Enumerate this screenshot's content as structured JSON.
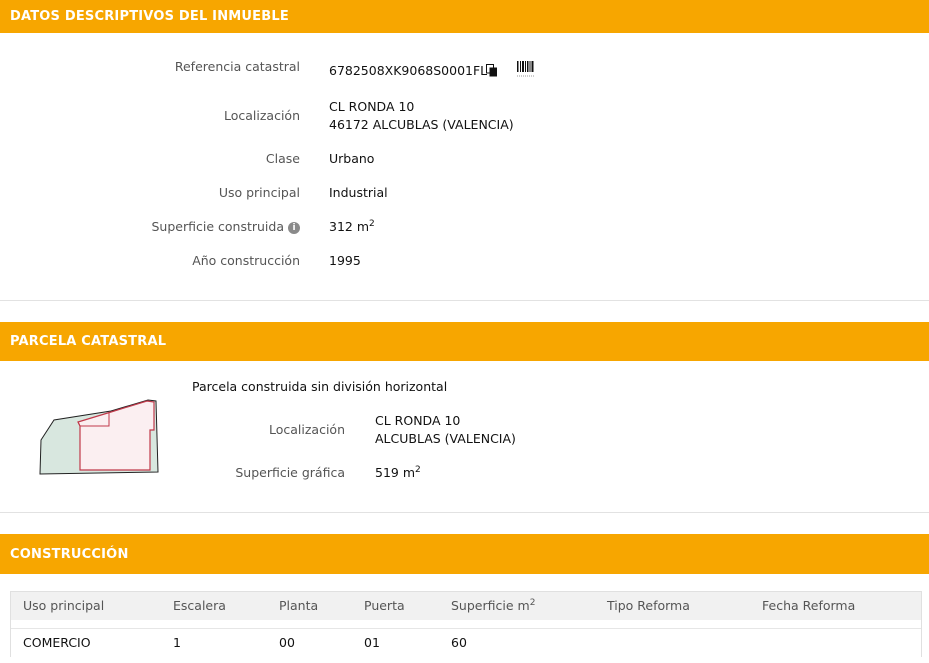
{
  "inmueble": {
    "header": "DATOS DESCRIPTIVOS DEL INMUEBLE",
    "ref_label": "Referencia catastral",
    "ref_value": "6782508XK9068S0001FL",
    "loc_label": "Localización",
    "loc_line1": "CL RONDA 10",
    "loc_line2": "46172 ALCUBLAS (VALENCIA)",
    "clase_label": "Clase",
    "clase_value": "Urbano",
    "uso_label": "Uso principal",
    "uso_value": "Industrial",
    "sup_label": "Superficie construida",
    "sup_value": "312 m",
    "sup_unit_exp": "2",
    "anio_label": "Año construcción",
    "anio_value": "1995"
  },
  "parcela": {
    "header": "PARCELA CATASTRAL",
    "title": "Parcela construida sin división horizontal",
    "loc_label": "Localización",
    "loc_line1": "CL RONDA 10",
    "loc_line2": "ALCUBLAS (VALENCIA)",
    "sup_label": "Superficie gráfica",
    "sup_value": "519 m",
    "sup_unit_exp": "2"
  },
  "construccion": {
    "header": "CONSTRUCCIÓN",
    "columns": [
      "Uso principal",
      "Escalera",
      "Planta",
      "Puerta",
      "Superficie m",
      "Tipo Reforma",
      "Fecha Reforma"
    ],
    "sup_col_exp": "2",
    "rows": [
      [
        "COMERCIO",
        "1",
        "00",
        "01",
        "60",
        "",
        ""
      ]
    ]
  },
  "icons": {
    "copy": "copy-icon",
    "barcode": "barcode-icon",
    "info": "info-icon"
  },
  "colors": {
    "header_bg": "#f7a600",
    "header_text": "#ffffff"
  }
}
